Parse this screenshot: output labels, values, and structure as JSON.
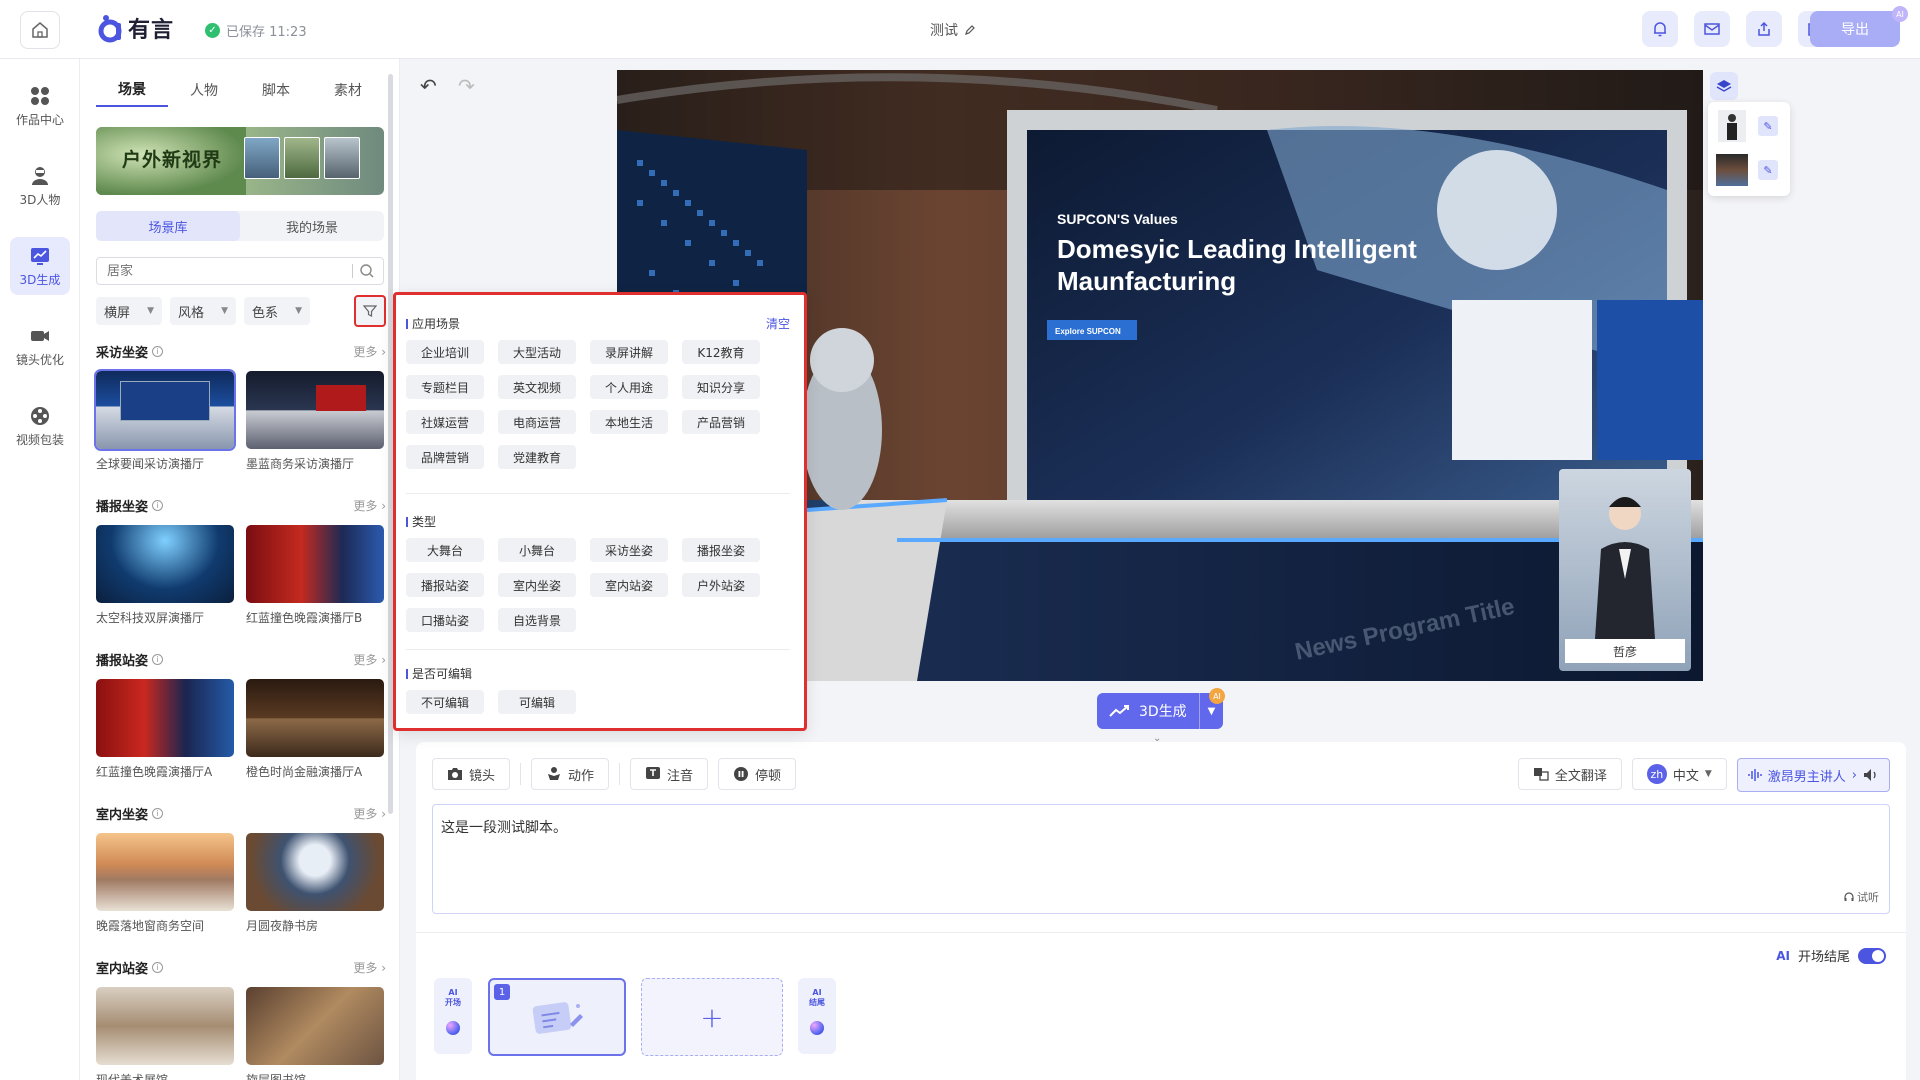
{
  "app": {
    "logo_text": "有言",
    "saved_text": "已保存 11:23",
    "doc_title": "测试",
    "export_label": "导出",
    "export_badge": "AI"
  },
  "leftnav": [
    {
      "label": "作品中心",
      "icon": "grid-icon"
    },
    {
      "label": "3D人物",
      "icon": "person-icon"
    },
    {
      "label": "3D生成",
      "icon": "chart-icon",
      "active": true
    },
    {
      "label": "镜头优化",
      "icon": "camera-icon"
    },
    {
      "label": "视频包装",
      "icon": "film-reel-icon"
    }
  ],
  "panel": {
    "tabs": [
      "场景",
      "人物",
      "脚本",
      "素材"
    ],
    "banner_text": "户外新视界",
    "subtabs": [
      "场景库",
      "我的场景"
    ],
    "search_placeholder": "居家",
    "filters": [
      "横屏",
      "风格",
      "色系"
    ],
    "more_label": "更多",
    "sections": [
      {
        "title": "采访坐姿",
        "cards": [
          "全球要闻采访演播厅",
          "墨蓝商务采访演播厅"
        ]
      },
      {
        "title": "播报坐姿",
        "cards": [
          "太空科技双屏演播厅",
          "红蓝撞色晚霞演播厅B"
        ]
      },
      {
        "title": "播报站姿",
        "cards": [
          "红蓝撞色晚霞演播厅A",
          "橙色时尚金融演播厅A"
        ]
      },
      {
        "title": "室内坐姿",
        "cards": [
          "晚霞落地窗商务空间",
          "月圆夜静书房"
        ]
      },
      {
        "title": "室内站姿",
        "cards": [
          "现代美术展馆",
          "旋层图书馆"
        ]
      }
    ]
  },
  "filter_panel": {
    "clear_label": "清空",
    "groups": [
      {
        "title": "应用场景",
        "options": [
          "企业培训",
          "大型活动",
          "录屏讲解",
          "K12教育",
          "专题栏目",
          "英文视频",
          "个人用途",
          "知识分享",
          "社媒运营",
          "电商运营",
          "本地生活",
          "产品营销",
          "品牌营销",
          "党建教育"
        ]
      },
      {
        "title": "类型",
        "options": [
          "大舞台",
          "小舞台",
          "采访坐姿",
          "播报坐姿",
          "播报站姿",
          "室内坐姿",
          "室内站姿",
          "户外站姿",
          "口播站姿",
          "自选背景"
        ]
      },
      {
        "title": "是否可编辑",
        "options": [
          "不可编辑",
          "可编辑"
        ]
      }
    ]
  },
  "stage": {
    "screen_heading": "SUPCON'S Values",
    "screen_title_line1": "Domesyic Leading Intelligent",
    "screen_title_line2": "Maunfacturing",
    "screen_button": "Explore SUPCON",
    "desk_text": "News Program Title",
    "presenter_name": "哲彦"
  },
  "ai_generate": {
    "label": "3D生成",
    "badge": "AI"
  },
  "editor": {
    "tools": [
      "镜头",
      "动作",
      "注音",
      "停顿"
    ],
    "translate_label": "全文翻译",
    "lang_code": "zh",
    "lang_label": "中文",
    "voice_label": "激昂男主讲人",
    "script_text": "这是一段测试脚本。",
    "listen_label": "试听",
    "opening_ai": "AI",
    "opening_label": "开场结尾",
    "clip_open": "AI\n开场",
    "clip_end": "AI\n结尾",
    "clip_number": "1",
    "add_symbol": "+"
  },
  "colors": {
    "accent": "#4b55e0",
    "highlight_border": "#e02f2f",
    "saved": "#2fbf71"
  }
}
